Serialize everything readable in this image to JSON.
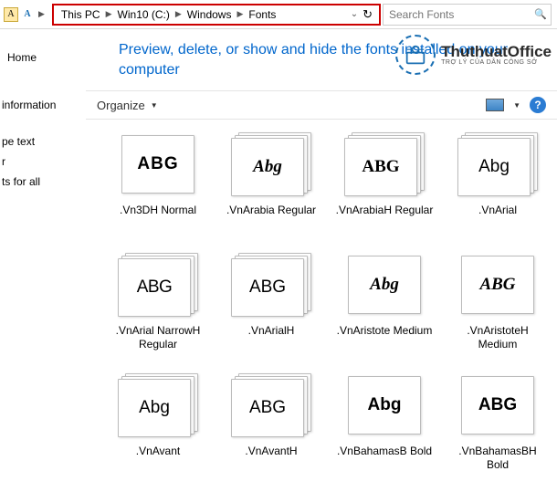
{
  "address": {
    "crumbs": [
      "This PC",
      "Win10 (C:)",
      "Windows",
      "Fonts"
    ]
  },
  "search": {
    "placeholder": "Search Fonts"
  },
  "sidebar": {
    "home": "Home",
    "items": [
      "information",
      "pe text",
      "r",
      "ts for all"
    ]
  },
  "heading": "Preview, delete, or show and hide the fonts installed on your computer",
  "toolbar": {
    "organize": "Organize"
  },
  "fonts": [
    {
      "name": ".Vn3DH Normal",
      "glyph": "ABG",
      "style": "font-weight:800;letter-spacing:1px;font-family:Arial Black,Arial;",
      "multi": false
    },
    {
      "name": ".VnArabia Regular",
      "glyph": "Abg",
      "style": "font-family:'Brush Script MT',cursive;font-style:italic;font-weight:700;",
      "multi": true
    },
    {
      "name": ".VnArabiaH Regular",
      "glyph": "ABG",
      "style": "font-family:'Old English Text MT','Times New Roman',serif;font-weight:700;",
      "multi": true
    },
    {
      "name": ".VnArial",
      "glyph": "Abg",
      "style": "font-family:Arial,sans-serif;font-weight:400;",
      "multi": true
    },
    {
      "name": ".VnArial NarrowH Regular",
      "glyph": "ABG",
      "style": "font-family:'Arial Narrow',Arial,sans-serif;font-weight:400;letter-spacing:-.5px;",
      "multi": true
    },
    {
      "name": ".VnArialH",
      "glyph": "ABG",
      "style": "font-family:Arial,sans-serif;font-weight:400;",
      "multi": true
    },
    {
      "name": ".VnAristote Medium",
      "glyph": "Abg",
      "style": "font-family:'Edwardian Script ITC','Brush Script MT',cursive;font-style:italic;",
      "multi": false
    },
    {
      "name": ".VnAristoteH Medium",
      "glyph": "ABG",
      "style": "font-family:'Edwardian Script ITC','Brush Script MT',cursive;font-style:italic;",
      "multi": false
    },
    {
      "name": ".VnAvant",
      "glyph": "Abg",
      "style": "font-family:'Century Gothic',Arial,sans-serif;font-weight:400;",
      "multi": true
    },
    {
      "name": ".VnAvantH",
      "glyph": "ABG",
      "style": "font-family:'Century Gothic',Arial,sans-serif;font-weight:400;",
      "multi": true
    },
    {
      "name": ".VnBahamasB Bold",
      "glyph": "Abg",
      "style": "font-family:Arial,sans-serif;font-weight:900;",
      "multi": false
    },
    {
      "name": ".VnBahamasBH Bold",
      "glyph": "ABG",
      "style": "font-family:Arial,sans-serif;font-weight:900;",
      "multi": false
    }
  ],
  "watermark": {
    "brand": "ThuthuatOffice",
    "tagline": "TRỢ LÝ CỦA DÂN CÔNG SỞ"
  }
}
